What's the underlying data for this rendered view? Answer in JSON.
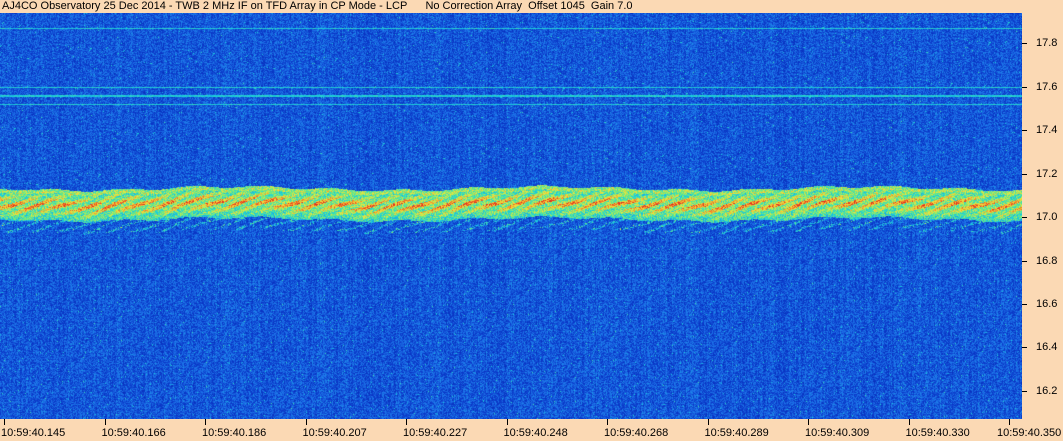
{
  "title": "AJ4CO Observatory 25 Dec 2014 - TWB 2 MHz IF on TFD Array in CP Mode - LCP      No Correction Array  Offset 1045  Gain 7.0",
  "colors": {
    "background": "#FBD9B4",
    "spectrogram_base": "#0A2FA6",
    "band_low": "#19E0C8",
    "band_mid": "#F5E43A",
    "band_high": "#E83A24"
  },
  "chart_data": {
    "type": "heatmap",
    "title": "AJ4CO Observatory 25 Dec 2014 - TWB 2 MHz IF on TFD Array in CP Mode - LCP      No Correction Array  Offset 1045  Gain 7.0",
    "xlabel": "",
    "ylabel": "",
    "x_tick_labels": [
      "10:59:40.145",
      "10:59:40.166",
      "10:59:40.186",
      "10:59:40.207",
      "10:59:40.227",
      "10:59:40.248",
      "10:59:40.268",
      "10:59:40.289",
      "10:59:40.309",
      "10:59:40.330",
      "10:59:40.350"
    ],
    "y_ticks": [
      16.2,
      16.4,
      16.6,
      16.8,
      17.0,
      17.2,
      17.4,
      17.6,
      17.8
    ],
    "y_tick_labels": [
      "16.2",
      "16.4",
      "16.6",
      "16.8",
      "17.0",
      "17.2",
      "17.4",
      "17.6",
      "17.8"
    ],
    "ylim": [
      16.07,
      17.94
    ],
    "emission_band": {
      "center_mhz": 17.07,
      "upper_edge_mhz": 17.12,
      "lower_edge_mhz": 17.01
    },
    "interference_lines_mhz": [
      17.87,
      17.6,
      17.56,
      17.52
    ],
    "grid": false
  }
}
